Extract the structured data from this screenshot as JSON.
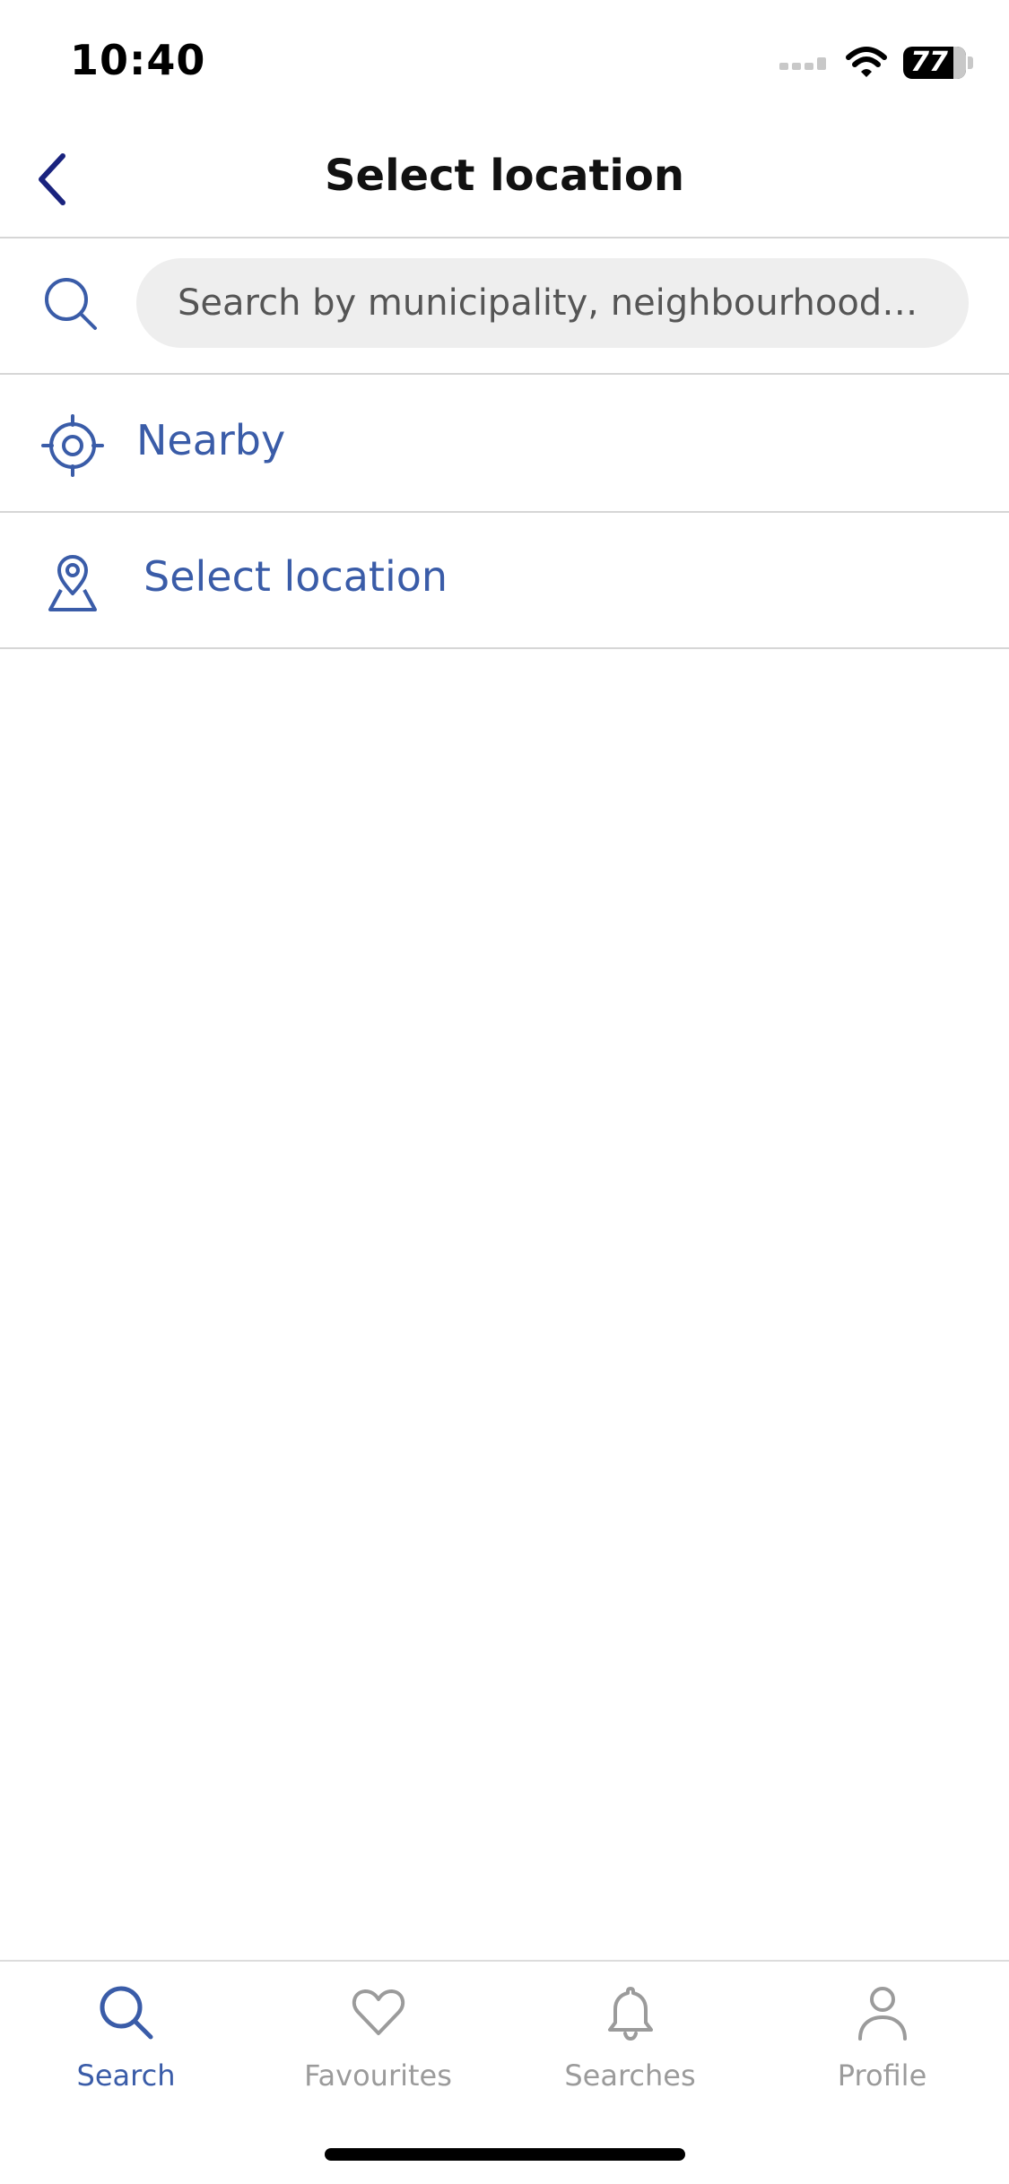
{
  "status_bar": {
    "time": "10:40",
    "battery": "77"
  },
  "header": {
    "title": "Select location",
    "back_icon": "chevron-left-icon"
  },
  "search": {
    "placeholder": "Search by municipality, neighbourhood,...",
    "value": ""
  },
  "options": [
    {
      "label": "Nearby",
      "icon": "crosshair-icon"
    },
    {
      "label": "Select location",
      "icon": "map-pin-icon"
    }
  ],
  "tabs": [
    {
      "label": "Search",
      "icon": "search-icon",
      "active": true
    },
    {
      "label": "Favourites",
      "icon": "heart-icon",
      "active": false
    },
    {
      "label": "Searches",
      "icon": "bell-icon",
      "active": false
    },
    {
      "label": "Profile",
      "icon": "person-icon",
      "active": false
    }
  ],
  "colors": {
    "accent": "#3a5ca8",
    "back_chevron": "#1a237e",
    "inactive": "#9b9b9b",
    "divider": "#d6d6d6",
    "search_bg": "#eeeeee"
  }
}
